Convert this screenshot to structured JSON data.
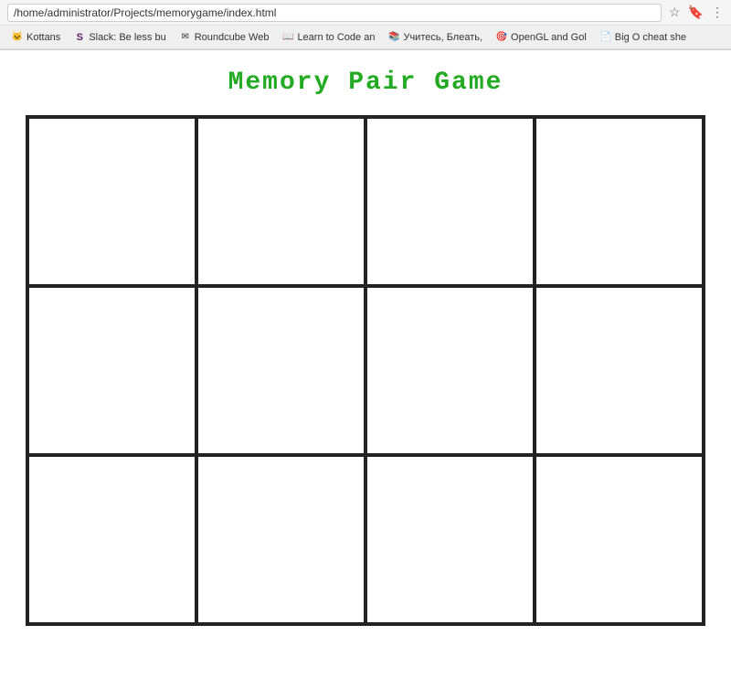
{
  "browser": {
    "address": "/home/administrator/Projects/memorygame/index.html",
    "bookmarks": [
      {
        "id": "kottans",
        "label": "Kottans",
        "favicon": "🐱"
      },
      {
        "id": "slack",
        "label": "Slack: Be less bu",
        "favicon": "S"
      },
      {
        "id": "roundcube",
        "label": "Roundcube Web",
        "favicon": "✉"
      },
      {
        "id": "learn-to-code",
        "label": "Learn to Code an",
        "favicon": "📖"
      },
      {
        "id": "uchites",
        "label": "Учитесь, Блеать,",
        "favicon": "📚"
      },
      {
        "id": "opengl",
        "label": "OpenGL and Gol",
        "favicon": "🎯"
      },
      {
        "id": "big-o",
        "label": "Big O cheat she",
        "favicon": "📄"
      }
    ]
  },
  "page": {
    "title": "Memory Pair Game",
    "cards": [
      {
        "id": 1
      },
      {
        "id": 2
      },
      {
        "id": 3
      },
      {
        "id": 4
      },
      {
        "id": 5
      },
      {
        "id": 6
      },
      {
        "id": 7
      },
      {
        "id": 8
      },
      {
        "id": 9
      },
      {
        "id": 10
      },
      {
        "id": 11
      },
      {
        "id": 12
      }
    ]
  }
}
